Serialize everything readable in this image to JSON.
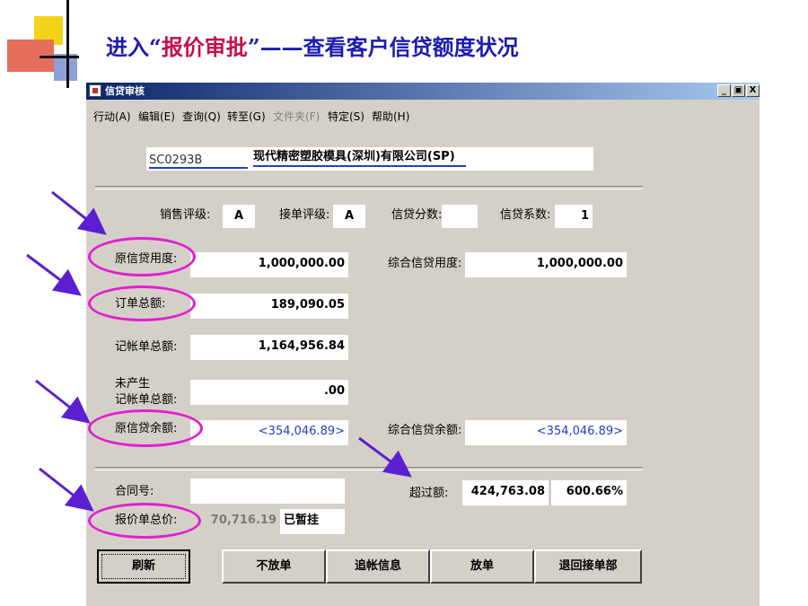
{
  "slide": {
    "title_pre": "进入",
    "title_quote_open": "“",
    "title_highlight": "报价审批",
    "title_quote_close": "”",
    "title_post": "——查看客户信贷额度状况"
  },
  "window": {
    "title": "信贷审核",
    "controls": {
      "minimize": "_",
      "restore": "▣",
      "close": "X"
    }
  },
  "menu": [
    {
      "label": "行动(A)",
      "enabled": true
    },
    {
      "label": "编辑(E)",
      "enabled": true
    },
    {
      "label": "查询(Q)",
      "enabled": true
    },
    {
      "label": "转至(G)",
      "enabled": true
    },
    {
      "label": "文件夹(F)",
      "enabled": false
    },
    {
      "label": "特定(S)",
      "enabled": true
    },
    {
      "label": "帮助(H)",
      "enabled": true
    }
  ],
  "customer": {
    "code": "SC0293B",
    "name": "现代精密塑胶模具(深圳)有限公司(SP)"
  },
  "ratings": {
    "sales_label": "销售评级:",
    "sales_value": "A",
    "order_label": "接单评级:",
    "order_value": "A",
    "score_label": "信贷分数:",
    "score_value": "",
    "factor_label": "信贷系数:",
    "factor_value": "1"
  },
  "credit": {
    "orig_limit_label": "原信贷用度:",
    "orig_limit_value": "1,000,000.00",
    "total_limit_label": "综合信贷用度:",
    "total_limit_value": "1,000,000.00",
    "order_total_label": "订单总额:",
    "order_total_value": "189,090.05",
    "ledger_total_label": "记帐单总额:",
    "ledger_total_value": "1,164,956.84",
    "unbilled_label_1": "未产生",
    "unbilled_label_2": "记帐单总额:",
    "unbilled_value": ".00",
    "orig_balance_label": "原信贷余额:",
    "orig_balance_value": "<354,046.89>",
    "total_balance_label": "综合信贷余额:",
    "total_balance_value": "<354,046.89>"
  },
  "contract": {
    "contract_label": "合同号:",
    "contract_value": "",
    "quote_total_label": "报价单总价:",
    "quote_total_value": "70,716.19",
    "quote_status": "已暂挂",
    "excess_label": "超过额:",
    "excess_value": "424,763.08",
    "excess_percent": "600.66%"
  },
  "buttons": {
    "refresh": "刷新",
    "reject": "不放单",
    "ledger_info": "追帐信息",
    "release": "放单",
    "return": "退回接单部"
  },
  "colors": {
    "title_blue": "#1b1bb0",
    "title_highlight": "#c4104a",
    "annotation": "#e020d0",
    "arrow": "#5a1fd0"
  }
}
